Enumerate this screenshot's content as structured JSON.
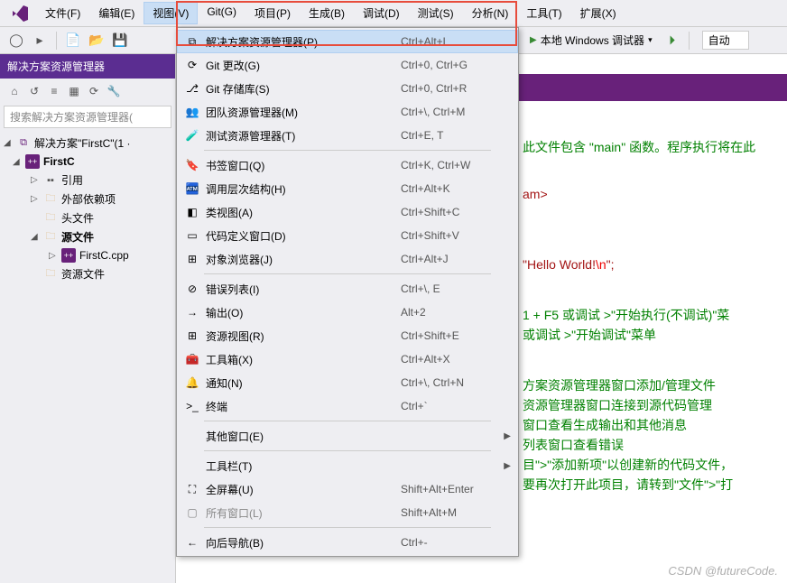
{
  "menubar": {
    "items": [
      "文件(F)",
      "编辑(E)",
      "视图(V)",
      "Git(G)",
      "项目(P)",
      "生成(B)",
      "调试(D)",
      "测试(S)",
      "分析(N)",
      "工具(T)",
      "扩展(X)"
    ],
    "open_index": 2
  },
  "toolbar": {
    "debug_target": "本地 Windows 调试器",
    "auto": "自动"
  },
  "solution_panel": {
    "title": "解决方案资源管理器",
    "search_placeholder": "搜索解决方案资源管理器(",
    "root": "解决方案\"FirstC\"(1 ·",
    "project": "FirstC",
    "nodes": {
      "references": "引用",
      "external": "外部依赖项",
      "headers": "头文件",
      "sources": "源文件",
      "source_file": "FirstC.cpp",
      "resources": "资源文件"
    }
  },
  "view_menu": [
    {
      "icon": "⧉",
      "label": "解决方案资源管理器(P)",
      "shortcut": "Ctrl+Alt+L",
      "selected": true
    },
    {
      "icon": "⟳",
      "label": "Git 更改(G)",
      "shortcut": "Ctrl+0, Ctrl+G"
    },
    {
      "icon": "⎇",
      "label": "Git 存储库(S)",
      "shortcut": "Ctrl+0, Ctrl+R"
    },
    {
      "icon": "👥",
      "label": "团队资源管理器(M)",
      "shortcut": "Ctrl+\\, Ctrl+M"
    },
    {
      "icon": "🧪",
      "label": "测试资源管理器(T)",
      "shortcut": "Ctrl+E, T"
    },
    {
      "sep": true
    },
    {
      "icon": "🔖",
      "label": "书签窗口(Q)",
      "shortcut": "Ctrl+K, Ctrl+W"
    },
    {
      "icon": "🏧",
      "label": "调用层次结构(H)",
      "shortcut": "Ctrl+Alt+K"
    },
    {
      "icon": "◧",
      "label": "类视图(A)",
      "shortcut": "Ctrl+Shift+C"
    },
    {
      "icon": "▭",
      "label": "代码定义窗口(D)",
      "shortcut": "Ctrl+Shift+V"
    },
    {
      "icon": "⊞",
      "label": "对象浏览器(J)",
      "shortcut": "Ctrl+Alt+J"
    },
    {
      "sep": true
    },
    {
      "icon": "⊘",
      "label": "错误列表(I)",
      "shortcut": "Ctrl+\\, E"
    },
    {
      "icon": "→",
      "label": "输出(O)",
      "shortcut": "Alt+2"
    },
    {
      "icon": "⊞",
      "label": "资源视图(R)",
      "shortcut": "Ctrl+Shift+E"
    },
    {
      "icon": "🧰",
      "label": "工具箱(X)",
      "shortcut": "Ctrl+Alt+X"
    },
    {
      "icon": "🔔",
      "label": "通知(N)",
      "shortcut": "Ctrl+\\, Ctrl+N"
    },
    {
      "icon": ">_",
      "label": "终端",
      "shortcut": "Ctrl+`"
    },
    {
      "sep": true
    },
    {
      "icon": "",
      "label": "其他窗口(E)",
      "shortcut": "",
      "submenu": true
    },
    {
      "sep": true
    },
    {
      "icon": "",
      "label": "工具栏(T)",
      "shortcut": "",
      "submenu": true
    },
    {
      "icon": "⛶",
      "label": "全屏幕(U)",
      "shortcut": "Shift+Alt+Enter"
    },
    {
      "icon": "▢",
      "label": "所有窗口(L)",
      "shortcut": "Shift+Alt+M",
      "disabled": true
    },
    {
      "sep": true
    },
    {
      "icon": "←",
      "label": "向后导航(B)",
      "shortcut": "Ctrl+-"
    }
  ],
  "editor_fragments": {
    "l1": "此文件包含 \"main\" 函数。程序执行将在此",
    "l2": "am>",
    "l3a": "\"Hello World!",
    "l3b": "\\n",
    "l3c": "\";",
    "l4": "1 + F5 或调试 >\"开始执行(不调试)\"菜",
    "l5": "或调试 >\"开始调试\"菜单",
    "l6": "方案资源管理器窗口添加/管理文件",
    "l7": "资源管理器窗口连接到源代码管理",
    "l8": "窗口查看生成输出和其他消息",
    "l9": "列表窗口查看错误",
    "l10": "目\">\"添加新项\"以创建新的代码文件，",
    "l11": "要再次打开此项目，请转到\"文件\">\"打"
  },
  "watermark": "CSDN @futureCode."
}
